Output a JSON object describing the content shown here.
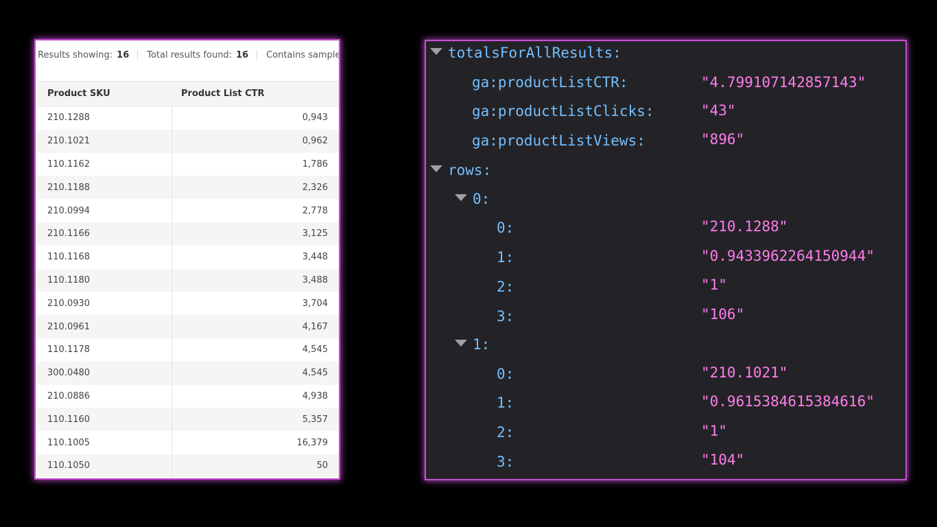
{
  "summary": {
    "results_showing_label": "Results showing:",
    "results_showing_value": "16",
    "total_found_label": "Total results found:",
    "total_found_value": "16",
    "sampled_text": "Contains sampled d"
  },
  "table": {
    "col_sku": "Product SKU",
    "col_ctr": "Product List CTR",
    "rows": [
      {
        "sku": "210.1288",
        "ctr": "0,943"
      },
      {
        "sku": "210.1021",
        "ctr": "0,962"
      },
      {
        "sku": "110.1162",
        "ctr": "1,786"
      },
      {
        "sku": "210.1188",
        "ctr": "2,326"
      },
      {
        "sku": "210.0994",
        "ctr": "2,778"
      },
      {
        "sku": "210.1166",
        "ctr": "3,125"
      },
      {
        "sku": "110.1168",
        "ctr": "3,448"
      },
      {
        "sku": "110.1180",
        "ctr": "3,488"
      },
      {
        "sku": "210.0930",
        "ctr": "3,704"
      },
      {
        "sku": "210.0961",
        "ctr": "4,167"
      },
      {
        "sku": "110.1178",
        "ctr": "4,545"
      },
      {
        "sku": "300.0480",
        "ctr": "4,545"
      },
      {
        "sku": "210.0886",
        "ctr": "4,938"
      },
      {
        "sku": "110.1160",
        "ctr": "5,357"
      },
      {
        "sku": "110.1005",
        "ctr": "16,379"
      },
      {
        "sku": "110.1050",
        "ctr": "50"
      }
    ]
  },
  "json_viewer": {
    "totals_key": "totalsForAllResults:",
    "totals": [
      {
        "key": "ga:productListCTR:",
        "value": "\"4.799107142857143\""
      },
      {
        "key": "ga:productListClicks:",
        "value": "\"43\""
      },
      {
        "key": "ga:productListViews:",
        "value": "\"896\""
      }
    ],
    "rows_key": "rows:",
    "rows": [
      {
        "key": "0:",
        "items": [
          {
            "key": "0:",
            "value": "\"210.1288\""
          },
          {
            "key": "1:",
            "value": "\"0.9433962264150944\""
          },
          {
            "key": "2:",
            "value": "\"1\""
          },
          {
            "key": "3:",
            "value": "\"106\""
          }
        ]
      },
      {
        "key": "1:",
        "items": [
          {
            "key": "0:",
            "value": "\"210.1021\""
          },
          {
            "key": "1:",
            "value": "\"0.9615384615384616\""
          },
          {
            "key": "2:",
            "value": "\"1\""
          },
          {
            "key": "3:",
            "value": "\"104\""
          }
        ]
      }
    ]
  },
  "colors": {
    "glow": "#c84fd6",
    "json_key": "#75bfff",
    "json_string": "#ff7de9",
    "json_background": "#232327"
  }
}
